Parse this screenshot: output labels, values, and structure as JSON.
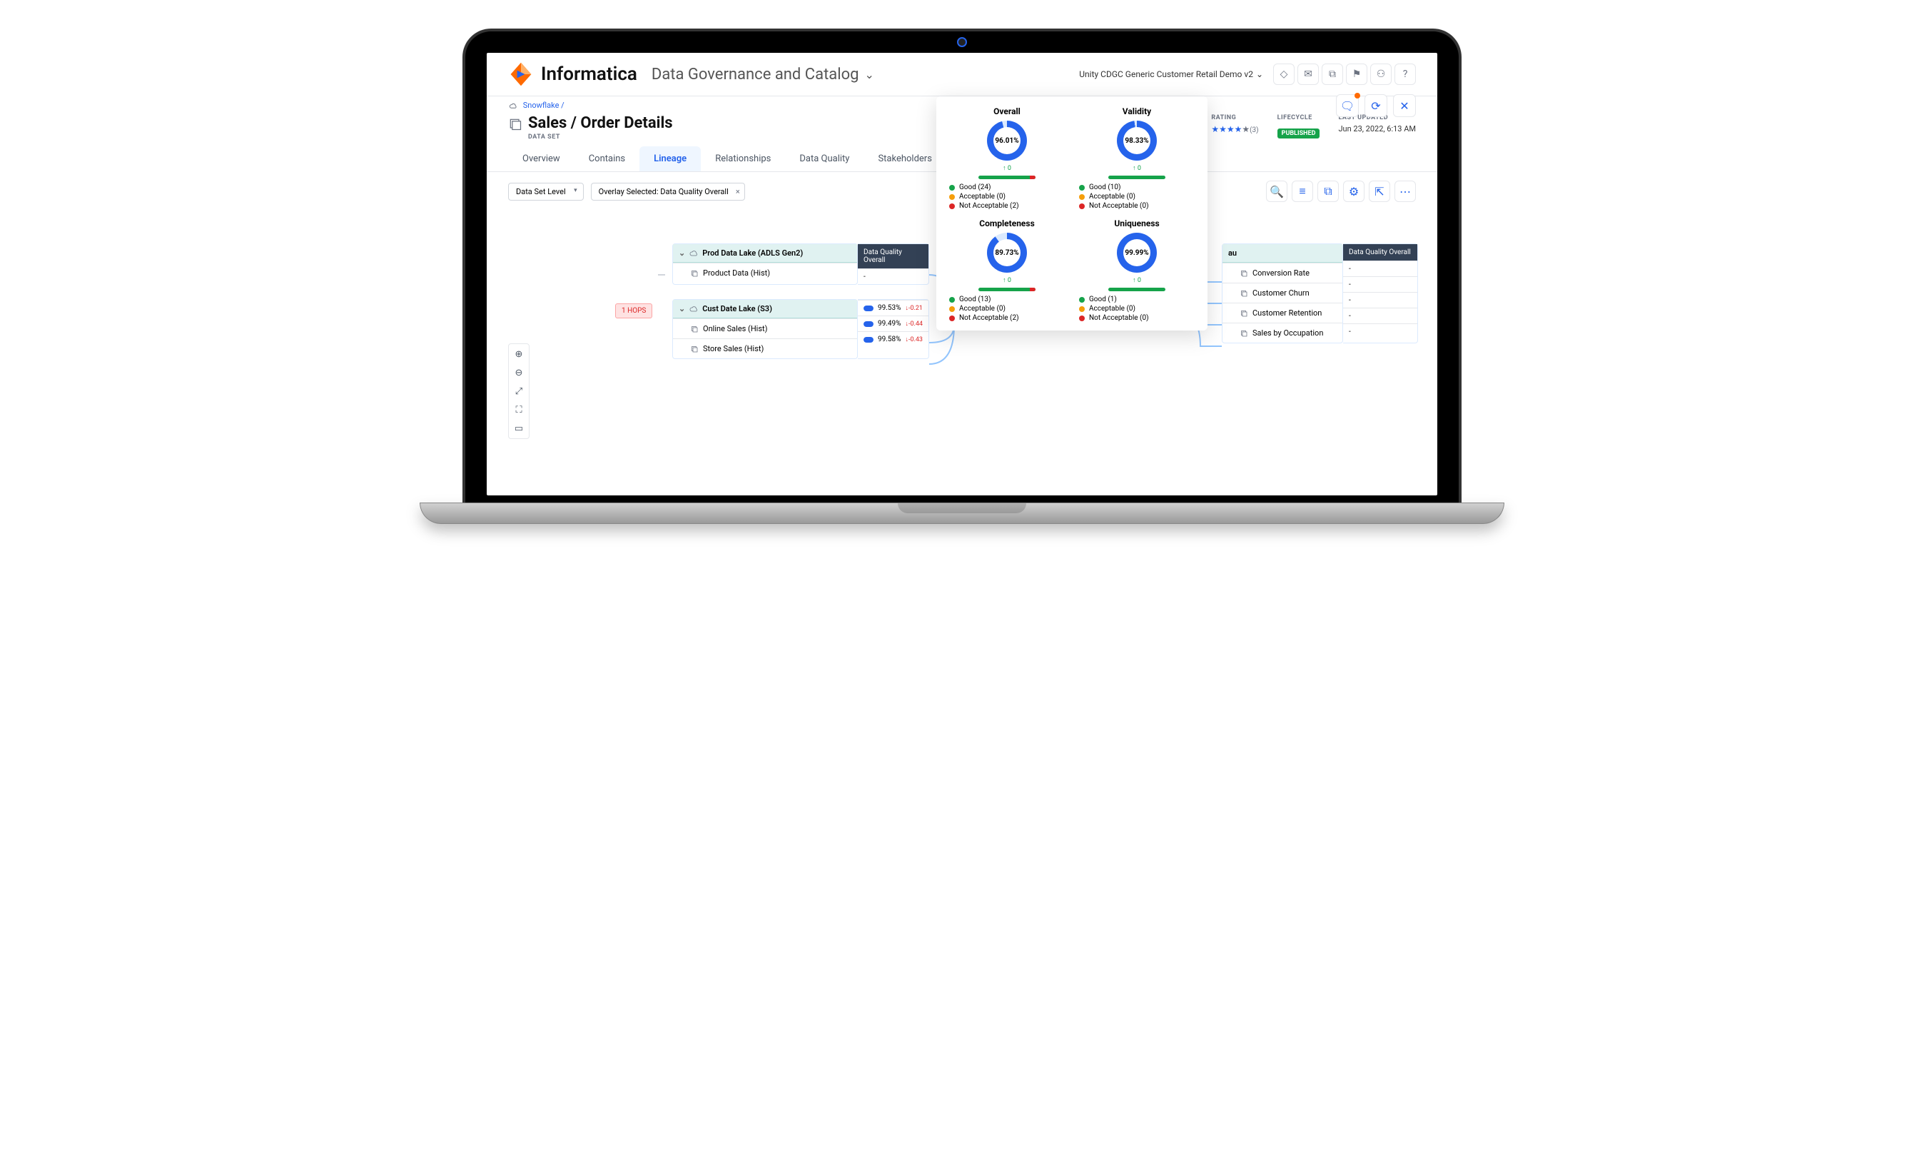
{
  "brand": "Informatica",
  "module": "Data Governance and Catalog",
  "context": "Unity CDGC Generic Customer Retail Demo v2",
  "breadcrumb": "Snowflake",
  "page_title": "Sales / Order Details",
  "asset_type": "DATA SET",
  "meta": {
    "rating_label": "RATING",
    "rating_count": "(3)",
    "lifecycle_label": "LIFECYCLE",
    "lifecycle_value": "PUBLISHED",
    "updated_label": "LAST UPDATED",
    "updated_value": "Jun 23, 2022, 6:13 AM"
  },
  "tabs": [
    "Overview",
    "Contains",
    "Lineage",
    "Relationships",
    "Data Quality",
    "Stakeholders"
  ],
  "active_tab": "Lineage",
  "level_select": "Data Set Level",
  "overlay_chip": "Overlay Selected: Data Quality Overall",
  "hops": "1 HOPS",
  "dq_header": "Data Quality Overall",
  "lineage": {
    "left_groups": [
      {
        "name": "Prod Data Lake (ADLS Gen2)",
        "items": [
          {
            "name": "Product Data (Hist)",
            "dq": null
          }
        ]
      },
      {
        "name": "Cust Date Lake (S3)",
        "items": [
          {
            "name": "Online Sales (Hist)",
            "pct": "99.53%",
            "delta": "-0.21",
            "dir": "down",
            "fill": 98
          },
          {
            "name": "",
            "pct": "99.49%",
            "delta": "-0.44",
            "dir": "down",
            "fill": 97
          },
          {
            "name": "Store Sales (Hist)",
            "pct": "99.58%",
            "delta": "-0.43",
            "dir": "down",
            "fill": 97
          }
        ]
      }
    ],
    "center_group": {
      "name": "Snowflake",
      "item": "Sales / Order Details",
      "pct": "96.01%",
      "delta": "0",
      "head_pct": "96.01%",
      "head_delta": "0"
    },
    "right_group": {
      "name": "au",
      "items": [
        "Conversion Rate",
        "Customer Churn",
        "Customer Retention",
        "Sales by Occupation"
      ]
    }
  },
  "popover": {
    "metrics": [
      {
        "title": "Overall",
        "pct": "96.01%",
        "fill": 96,
        "trend": "↑ 0",
        "good": 24,
        "acc": 0,
        "na": 2,
        "na_bar": true
      },
      {
        "title": "Validity",
        "pct": "98.33%",
        "fill": 98,
        "trend": "↑ 0",
        "good": 10,
        "acc": 0,
        "na": 0
      },
      {
        "title": "Completeness",
        "pct": "89.73%",
        "fill": 90,
        "trend": "↑ 0",
        "good": 13,
        "acc": 0,
        "na": 2,
        "na_bar": true
      },
      {
        "title": "Uniqueness",
        "pct": "99.99%",
        "fill": 100,
        "trend": "↑ 0",
        "good": 1,
        "acc": 0,
        "na": 0
      }
    ],
    "legend_labels": {
      "good": "Good",
      "acc": "Acceptable",
      "na": "Not Acceptable"
    }
  }
}
